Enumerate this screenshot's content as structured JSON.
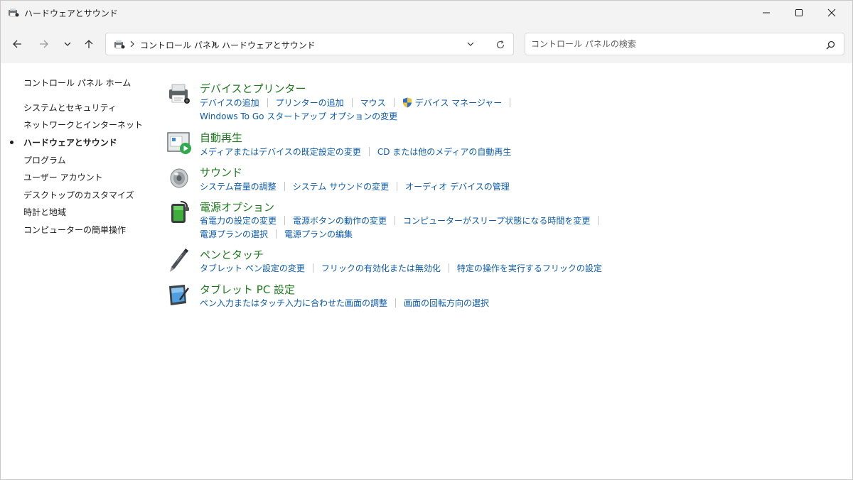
{
  "window": {
    "title": "ハードウェアとサウンド"
  },
  "address": {
    "crumbs": [
      "コントロール パネル",
      "ハードウェアとサウンド"
    ]
  },
  "search": {
    "placeholder": "コントロール パネルの検索"
  },
  "leftnav": {
    "items": [
      {
        "label": "コントロール パネル ホーム"
      },
      {
        "label": "システムとセキュリティ"
      },
      {
        "label": "ネットワークとインターネット"
      },
      {
        "label": "ハードウェアとサウンド",
        "active": true
      },
      {
        "label": "プログラム"
      },
      {
        "label": "ユーザー アカウント"
      },
      {
        "label": "デスクトップのカスタマイズ"
      },
      {
        "label": "時計と地域"
      },
      {
        "label": "コンピューターの簡単操作"
      }
    ]
  },
  "categories": [
    {
      "title": "デバイスとプリンター",
      "icon": "printer-icon",
      "lines": [
        [
          "デバイスの追加",
          "プリンターの追加",
          "マウス",
          "デバイス マネージャー"
        ],
        [
          "Windows To Go スタートアップ オプションの変更"
        ]
      ]
    },
    {
      "title": "自動再生",
      "icon": "autoplay-icon",
      "lines": [
        [
          "メディアまたはデバイスの既定設定の変更",
          "CD または他のメディアの自動再生"
        ]
      ]
    },
    {
      "title": "サウンド",
      "icon": "speaker-icon",
      "lines": [
        [
          "システム音量の調整",
          "システム サウンドの変更",
          "オーディオ デバイスの管理"
        ]
      ]
    },
    {
      "title": "電源オプション",
      "icon": "battery-icon",
      "lines": [
        [
          "省電力の設定の変更",
          "電源ボタンの動作の変更",
          "コンピューターがスリープ状態になる時間を変更"
        ],
        [
          "電源プランの選択",
          "電源プランの編集"
        ]
      ]
    },
    {
      "title": "ペンとタッチ",
      "icon": "pen-icon",
      "lines": [
        [
          "タブレット ペン設定の変更",
          "フリックの有効化または無効化",
          "特定の操作を実行するフリックの設定"
        ]
      ]
    },
    {
      "title": "タブレット PC 設定",
      "icon": "tablet-icon",
      "lines": [
        [
          "ペン入力またはタッチ入力に合わせた画面の調整",
          "画面の回転方向の選択"
        ]
      ]
    }
  ],
  "colors": {
    "link": "#0b5cad",
    "category_title": "#1e7b1e",
    "chrome_background": "#f3f3f3"
  }
}
